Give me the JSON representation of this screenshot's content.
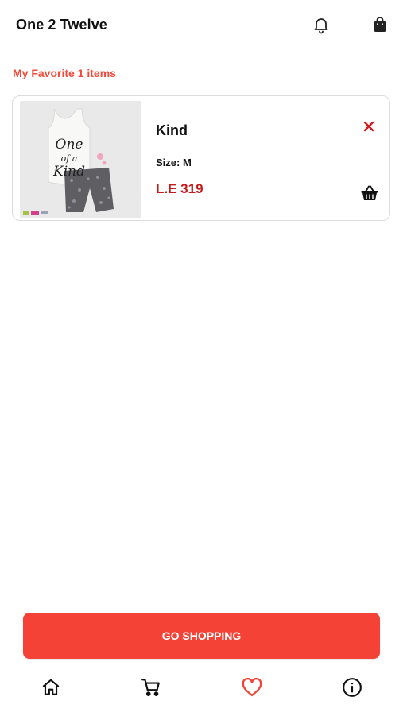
{
  "header": {
    "title": "One 2 Twelve",
    "icons": [
      "bell-icon",
      "shopping-bag-icon"
    ]
  },
  "favorites": {
    "heading": "My Favorite 1 items",
    "items": [
      {
        "name": "Kind",
        "size_label": "Size: M",
        "price": "L.E 319",
        "image_text": [
          "One",
          "of a",
          "Kind"
        ]
      }
    ]
  },
  "actions": {
    "go_shopping": "GO SHOPPING"
  },
  "bottom_nav": {
    "items": [
      "home-icon",
      "cart-icon",
      "heart-icon",
      "info-icon"
    ],
    "active": "heart-icon"
  },
  "colors": {
    "accent": "#f44336",
    "heading": "#f14a3a",
    "price": "#c81a1a",
    "remove": "#d01c1c"
  }
}
